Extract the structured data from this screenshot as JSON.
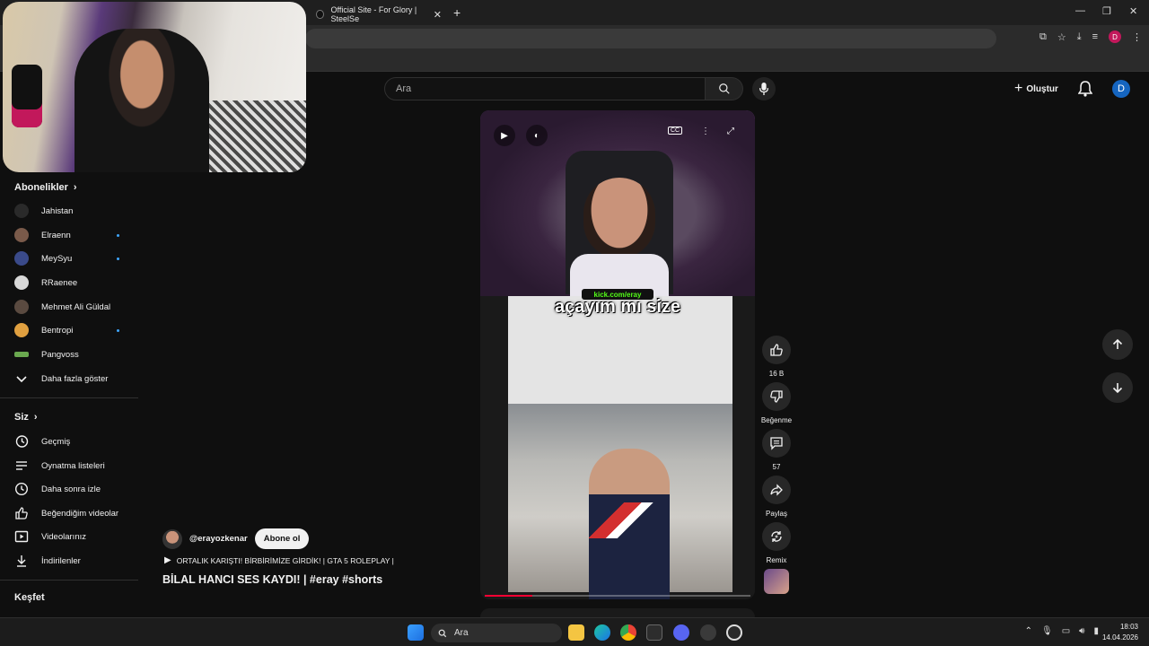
{
  "browser": {
    "tab_title": "Official Site - For Glory | SteelSe",
    "tab_close": "✕",
    "new_tab": "+"
  },
  "header": {
    "search_placeholder": "Ara",
    "create_label": "Oluştur",
    "avatar_letter": "D"
  },
  "sidebar": {
    "subscriptions_title": "Abonelikler",
    "subscriptions": [
      {
        "label": "Jahistan",
        "color": "#2a2a2a",
        "dot": false
      },
      {
        "label": "Elraenn",
        "color": "#7a5a4a",
        "dot": true
      },
      {
        "label": "MeySyu",
        "color": "#3a4a8a",
        "dot": true
      },
      {
        "label": "RRaenee",
        "color": "#d8d8d8",
        "dot": false
      },
      {
        "label": "Mehmet Ali Güldal",
        "color": "#5a4a40",
        "dot": false
      },
      {
        "label": "Bentropi",
        "color": "#e0a040",
        "dot": true
      },
      {
        "label": "Pangvoss",
        "color": "#6aa84f",
        "dot": false
      }
    ],
    "show_more": "Daha fazla göster",
    "you_title": "Siz",
    "you_items": [
      {
        "label": "Geçmiş",
        "icon": "history-icon"
      },
      {
        "label": "Oynatma listeleri",
        "icon": "playlist-icon"
      },
      {
        "label": "Daha sonra izle",
        "icon": "clock-icon"
      },
      {
        "label": "Beğendiğim videolar",
        "icon": "like-icon"
      },
      {
        "label": "Videolarınız",
        "icon": "video-icon"
      },
      {
        "label": "İndirilenler",
        "icon": "download-icon"
      }
    ],
    "explore_title": "Keşfet"
  },
  "player": {
    "kick_label": "kick.com/eray",
    "caption": "açayım mı size",
    "progress": 0.18
  },
  "actions": {
    "likes": "16 B",
    "dislike_label": "Beğenme",
    "comments": "57",
    "share_label": "Paylaş",
    "remix_label": "Remix"
  },
  "video": {
    "channel": "@erayozkenar",
    "subscribe_label": "Abone ol",
    "playlist_title": "ORTALIK KARIŞTI! BİRBİRİMİZE GİRDİK! | GTA 5 ROLEPLAY |",
    "title": "BİLAL HANCI SES KAYDI! | #eray #shorts"
  },
  "taskbar": {
    "search_label": "Ara",
    "time": "18:03",
    "date": "14.04.2026"
  }
}
